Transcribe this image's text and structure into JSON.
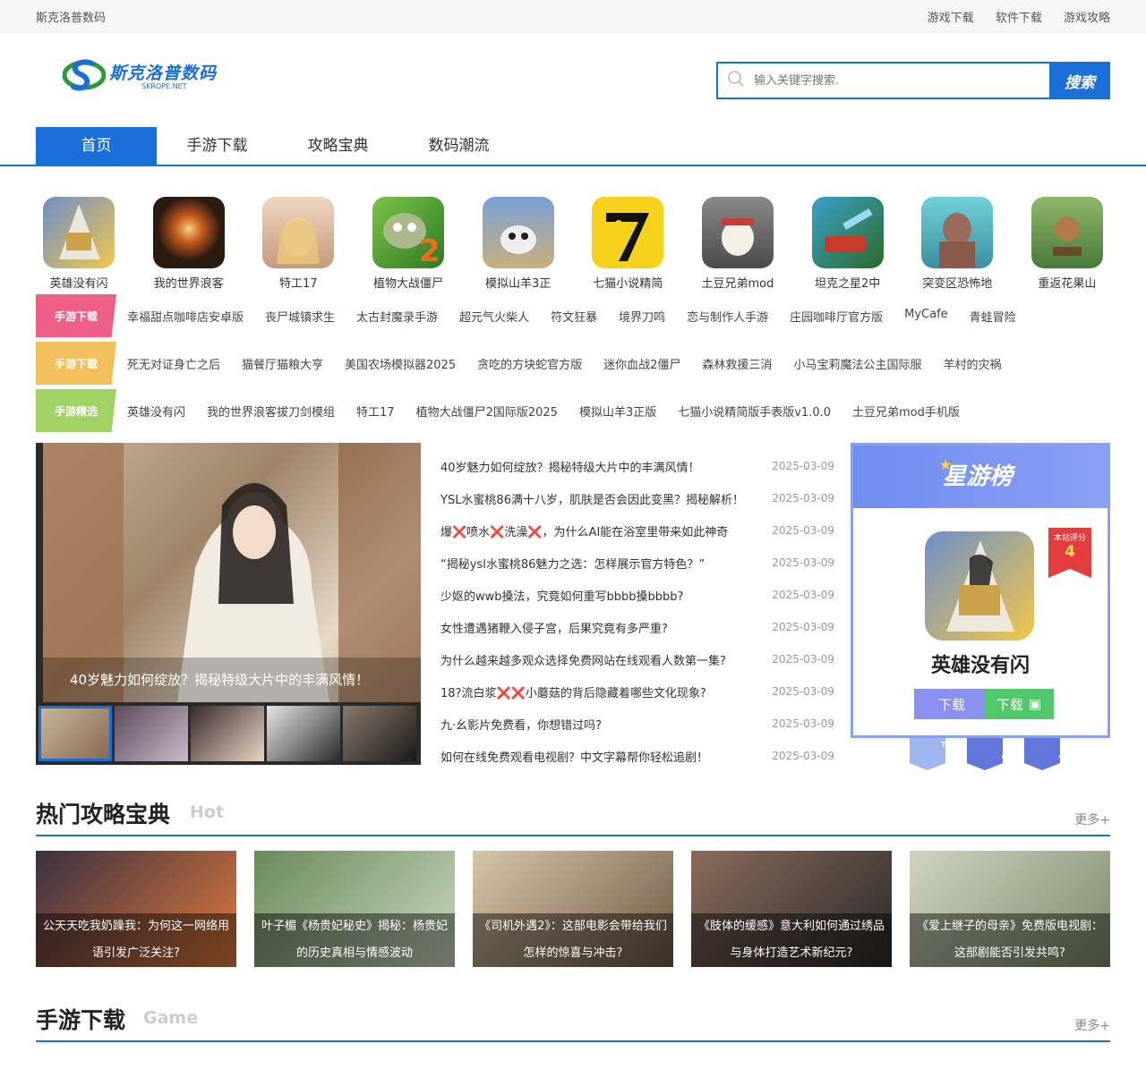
{
  "topbar": {
    "site_name": "斯克洛普数码",
    "links": [
      "游戏下载",
      "软件下载",
      "游戏攻略"
    ]
  },
  "logo": {
    "cn": "斯克洛普数码",
    "en": "SKROPE.NET"
  },
  "search": {
    "placeholder": "输入关键字搜索.",
    "button": "搜索"
  },
  "nav": [
    "首页",
    "手游下载",
    "攻略宝典",
    "数码潮流"
  ],
  "apps": [
    {
      "name": "英雄没有闪",
      "color": "#6d8fc9"
    },
    {
      "name": "我的世界浪客",
      "color": "#3a2a1a"
    },
    {
      "name": "特工17",
      "color": "#d9b79a"
    },
    {
      "name": "植物大战僵尸",
      "color": "#3a9a2f"
    },
    {
      "name": "模拟山羊3正",
      "color": "#7aa0d8"
    },
    {
      "name": "七猫小说精简",
      "color": "#f7d21c"
    },
    {
      "name": "土豆兄弟mod",
      "color": "#6a6a6a"
    },
    {
      "name": "坦克之星2中",
      "color": "#3aa1c9"
    },
    {
      "name": "突变区恐怖地",
      "color": "#4fb7c4"
    },
    {
      "name": "重返花果山",
      "color": "#6e9a4b"
    }
  ],
  "tagrows": [
    {
      "tag": "手游下载",
      "color": "#ee5f86",
      "words": [
        "幸福甜点咖啡店安卓版",
        "丧尸城镇求生",
        "太古封魔录手游",
        "超元气火柴人",
        "符文狂暴",
        "境界刀鸣",
        "恋与制作人手游",
        "庄园咖啡厅官方版",
        "MyCafe",
        "青蛙冒险"
      ]
    },
    {
      "tag": "手游下载",
      "color": "#f2c05a",
      "words": [
        "死无对证身亡之后",
        "猫餐厅猫粮大亨",
        "美国农场模拟器2025",
        "贪吃的方块蛇官方版",
        "迷你血战2僵尸",
        "森林救援三消",
        "小马宝莉魔法公主国际服",
        "羊村的灾祸"
      ]
    },
    {
      "tag": "手游精选",
      "color": "#9fd363",
      "words": [
        "英雄没有闪",
        "我的世界浪客拔刀剑模组",
        "特工17",
        "植物大战僵尸2国际版2025",
        "模拟山羊3正版",
        "七猫小说精简版手表版v1.0.0",
        "土豆兄弟mod手机版"
      ]
    }
  ],
  "slider": {
    "caption": "40岁魅力如何绽放？揭秘特级大片中的丰满风情！",
    "thumbs": 5
  },
  "news": [
    {
      "t": "40岁魅力如何绽放？揭秘特级大片中的丰满风情！",
      "d": "2025-03-09"
    },
    {
      "t": "YSL水蜜桃86满十八岁，肌肤是否会因此变黑？揭秘解析！",
      "d": "2025-03-09"
    },
    {
      "t": "爆❌喷水❌洗澡❌，为什么AI能在浴室里带来如此神奇",
      "d": "2025-03-09"
    },
    {
      "t": "“揭秘ysl水蜜桃86魅力之选：怎样展示官方特色？”",
      "d": "2025-03-09"
    },
    {
      "t": "少妪的wwb搡法，究竟如何重写bbbb搡bbbb?",
      "d": "2025-03-09"
    },
    {
      "t": "女性遭遇猪鞭入侵子宫，后果究竟有多严重?",
      "d": "2025-03-09"
    },
    {
      "t": "为什么越来越多观众选择免费网站在线观看人数第一集?",
      "d": "2025-03-09"
    },
    {
      "t": "18?流白浆❌❌小蘑菇的背后隐藏着哪些文化现象?",
      "d": "2025-03-09"
    },
    {
      "t": "九·幺影片免费看，你想错过吗?",
      "d": "2025-03-09"
    },
    {
      "t": "如何在线免费观看电视剧？中文字幕帮你轻松追剧！",
      "d": "2025-03-09"
    }
  ],
  "rank": {
    "title": "星游榜",
    "score_label": "本站评分",
    "score": "4",
    "game": "英雄没有闪",
    "btn_ios": "下载",
    "btn_android": "下载",
    "tabs": [
      "1",
      "2",
      "3"
    ],
    "top_label": "TOP"
  },
  "section_guides": {
    "title": "热门攻略宝典",
    "sub": "Hot",
    "more": "更多+",
    "cards": [
      {
        "t": "公天天吃我奶躁我：为何这一网络用语引发广泛关注?",
        "c1": "#3b3040",
        "c2": "#e07a3c"
      },
      {
        "t": "叶子楣《杨贵妃秘史》揭秘：杨贵妃的历史真相与情感波动",
        "c1": "#6a8a5a",
        "c2": "#c9d8c0"
      },
      {
        "t": "《司机外遇2》：这部电影会带给我们怎样的惊喜与冲击?",
        "c1": "#d7c5a8",
        "c2": "#6e5a45"
      },
      {
        "t": "《肢体的缓感》意大利如何通过绣品与身体打造艺术新纪元?",
        "c1": "#8a6b5a",
        "c2": "#2a2a2a"
      },
      {
        "t": "《爱上继子的母亲》免费版电视剧：这部剧能否引发共鸣?",
        "c1": "#cfd4c0",
        "c2": "#7c8a6b"
      }
    ]
  },
  "section_games": {
    "title": "手游下载",
    "sub": "Game",
    "more": "更多+"
  }
}
